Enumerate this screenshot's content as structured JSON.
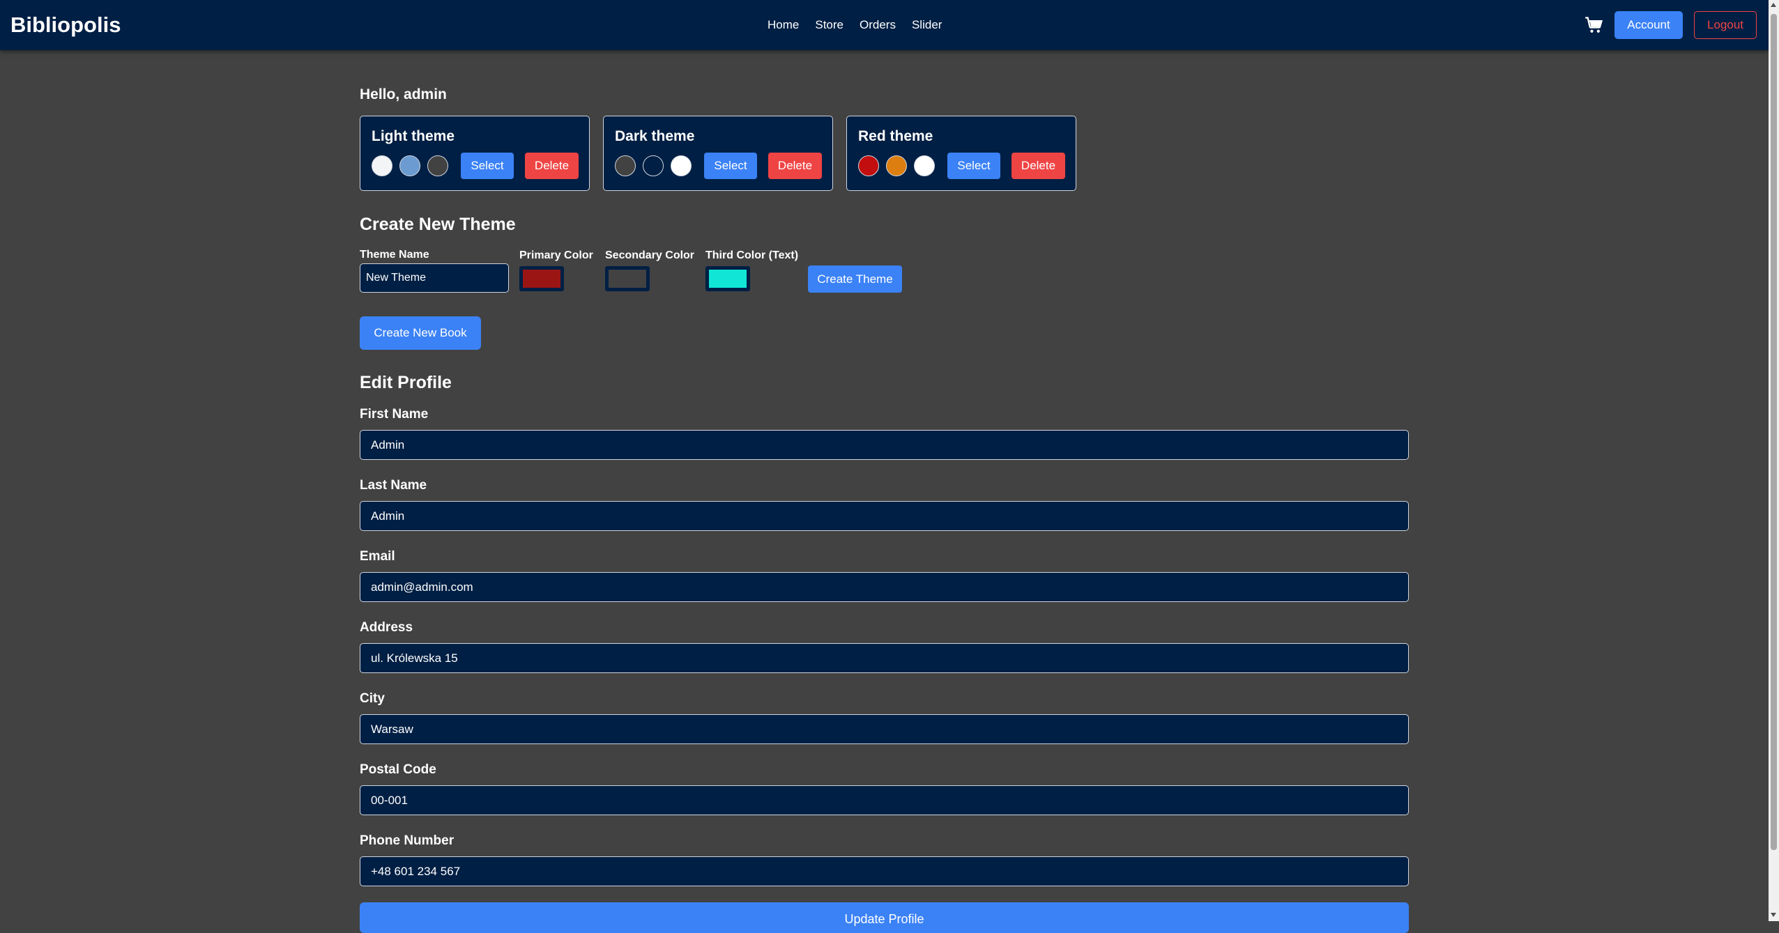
{
  "navbar": {
    "brand": "Bibliopolis",
    "links": [
      "Home",
      "Store",
      "Orders",
      "Slider"
    ],
    "cart_icon": "cart-icon",
    "account_label": "Account",
    "logout_label": "Logout"
  },
  "greeting": "Hello, admin",
  "themes": [
    {
      "name": "Light theme",
      "colors": [
        "#f3f4f6",
        "#6b9bd1",
        "#424242"
      ],
      "select_label": "Select",
      "delete_label": "Delete"
    },
    {
      "name": "Dark theme",
      "colors": [
        "#424242",
        "#001f44",
        "#ffffff"
      ],
      "select_label": "Select",
      "delete_label": "Delete"
    },
    {
      "name": "Red theme",
      "colors": [
        "#c20e0e",
        "#dc7e10",
        "#ffffff"
      ],
      "select_label": "Select",
      "delete_label": "Delete"
    }
  ],
  "create_theme": {
    "title": "Create New Theme",
    "name_label": "Theme Name",
    "name_value": "New Theme",
    "primary_label": "Primary Color",
    "primary_color": "#9b1515",
    "secondary_label": "Secondary Color",
    "secondary_color": "#424242",
    "third_label": "Third Color (Text)",
    "third_color": "#11e6d6",
    "button_label": "Create Theme"
  },
  "create_book_label": "Create New Book",
  "profile": {
    "title": "Edit Profile",
    "fields": [
      {
        "label": "First Name",
        "value": "Admin"
      },
      {
        "label": "Last Name",
        "value": "Admin"
      },
      {
        "label": "Email",
        "value": "admin@admin.com"
      },
      {
        "label": "Address",
        "value": "ul. Królewska 15"
      },
      {
        "label": "City",
        "value": "Warsaw"
      },
      {
        "label": "Postal Code",
        "value": "00-001"
      },
      {
        "label": "Phone Number",
        "value": "+48 601 234 567"
      }
    ],
    "update_label": "Update Profile"
  },
  "colors": {
    "background": "#424242",
    "navbar": "#001f44",
    "accent": "#3b82f6",
    "danger": "#ef4444"
  }
}
